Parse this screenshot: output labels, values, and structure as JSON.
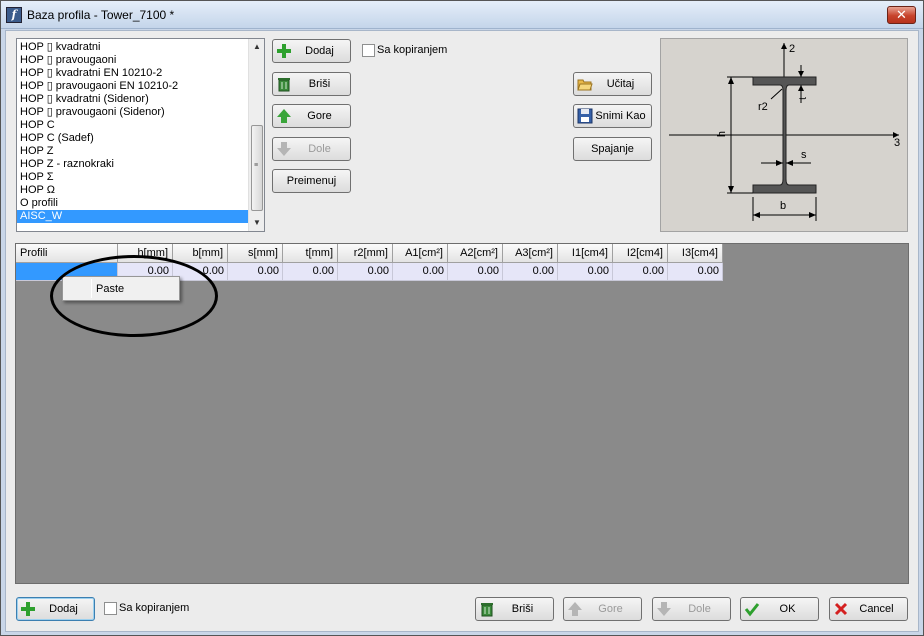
{
  "window": {
    "title": "Baza profila - Tower_7100 *",
    "close_glyph": "✕"
  },
  "profile_list": {
    "items": [
      "HOP ▯ kvadratni",
      "HOP ▯ pravougaoni",
      "HOP ▯ kvadratni EN 10210-2",
      "HOP ▯ pravougaoni EN 10210-2",
      "HOP ▯ kvadratni (Sidenor)",
      "HOP ▯ pravougaoni (Sidenor)",
      "HOP C",
      "HOP C (Sadef)",
      "HOP Z",
      "HOP Z - raznokraki",
      "HOP Σ",
      "HOP Ω",
      "O profili",
      "AISC_W"
    ],
    "selected": "AISC_W"
  },
  "top_buttons": {
    "add": "Dodaj",
    "copy_check": "Sa kopiranjem",
    "delete": "Briši",
    "up": "Gore",
    "down": "Dole",
    "rename": "Preimenuj",
    "load": "Učitaj",
    "save_as": "Snimi Kao",
    "merge": "Spajanje"
  },
  "diagram": {
    "axis2": "2",
    "axis3": "3",
    "r2": "r2",
    "t": "t",
    "h": "h",
    "s": "s",
    "b": "b"
  },
  "grid": {
    "headers": [
      "Profili",
      "h[mm]",
      "b[mm]",
      "s[mm]",
      "t[mm]",
      "r2[mm]",
      "A1[cm²]",
      "A2[cm²]",
      "A3[cm²]",
      "I1[cm4]",
      "I2[cm4]",
      "I3[cm4]"
    ],
    "row": [
      "",
      "0.00",
      "0.00",
      "0.00",
      "0.00",
      "0.00",
      "0.00",
      "0.00",
      "0.00",
      "0.00",
      "0.00",
      "0.00"
    ]
  },
  "context_menu": {
    "paste": "Paste"
  },
  "bottom_buttons": {
    "add": "Dodaj",
    "copy_check": "Sa kopiranjem",
    "delete": "Briši",
    "up": "Gore",
    "down": "Dole",
    "ok": "OK",
    "cancel": "Cancel"
  },
  "colors": {
    "selection": "#3399ff",
    "grid_bg": "#8a8a8a",
    "row_bg": "#e6e6f8"
  }
}
